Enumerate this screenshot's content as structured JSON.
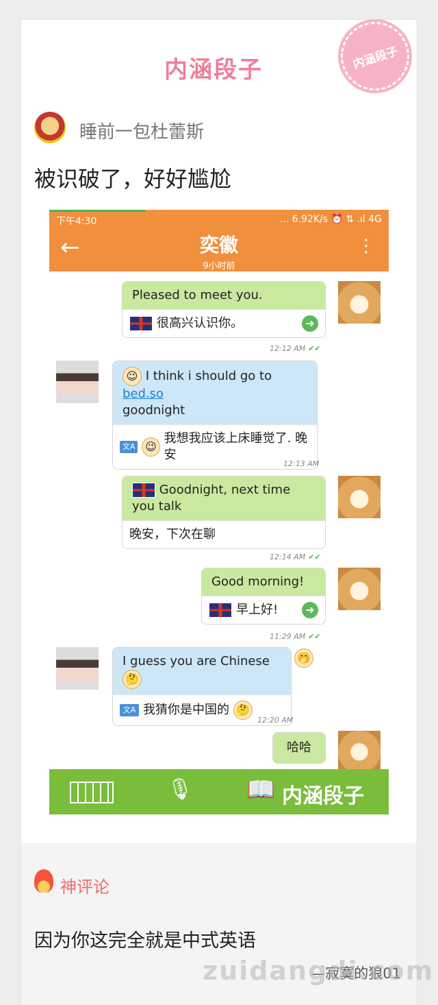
{
  "header": {
    "brand": "内涵段子",
    "stamp": "内涵段子"
  },
  "post": {
    "author": "睡前一包杜蕾斯",
    "title": "被识破了，好好尴尬"
  },
  "screenshot": {
    "status_bar": {
      "time": "下午4:30",
      "right": "... 6.92K/s ⏰ ⇅ .ıl 4G"
    },
    "chat": {
      "back_icon": "←",
      "name": "奕徽",
      "subtitle": "9小时前",
      "more_icon": "⋮"
    },
    "messages": [
      {
        "side": "right",
        "text": "Pleased to meet you.",
        "translation": "很高兴认识你。",
        "time": "12:12 AM"
      },
      {
        "side": "left",
        "text_pre": "I think i should go to ",
        "text_link": "bed.so",
        "text_post": "goodnight",
        "translation": "我想我应该上床睡觉了. 晚安",
        "time": "12:13 AM"
      },
      {
        "side": "right",
        "text": "Goodnight, next time you talk",
        "translation": "晚安，下次在聊",
        "time": "12:14 AM"
      },
      {
        "side": "right",
        "text": "Good morning!",
        "translation": "早上好!",
        "time": "11:29 AM"
      },
      {
        "side": "left",
        "text": "I guess you are Chinese",
        "translation": "我猜你是中国的",
        "time": "12:20 AM"
      },
      {
        "side": "right",
        "text": "哈哈"
      }
    ],
    "bottom_bar": {
      "watermark": "内涵段子"
    },
    "icons": {
      "translate": "文A",
      "send": "➜",
      "read_tick": "✔✔"
    }
  },
  "comments": {
    "label": "神评论",
    "text": "因为你这完全就是中式英语",
    "author": "—寂寞的狼01"
  },
  "site_watermark": "zuidangdi.com"
}
